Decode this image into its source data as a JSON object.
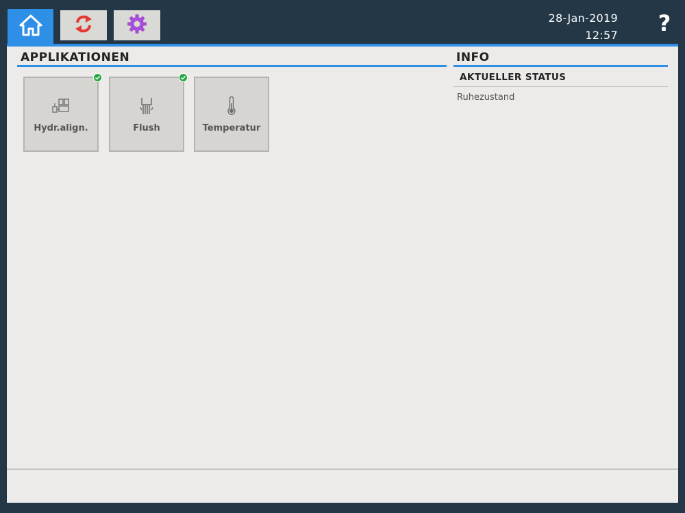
{
  "header": {
    "date": "28-Jan-2019",
    "time": "12:57",
    "help_label": "?",
    "tabs": [
      {
        "name": "home",
        "icon": "home-icon",
        "active": true
      },
      {
        "name": "sync",
        "icon": "sync-arrows-icon",
        "active": false
      },
      {
        "name": "settings",
        "icon": "gear-icon",
        "active": false
      }
    ]
  },
  "applications": {
    "title": "APPLIKATIONEN",
    "items": [
      {
        "label": "Hydr.align.",
        "icon": "hydraulic-align-icon",
        "completed": true
      },
      {
        "label": "Flush",
        "icon": "flush-icon",
        "completed": true
      },
      {
        "label": "Temperatur",
        "icon": "thermometer-icon",
        "completed": false
      }
    ]
  },
  "info": {
    "title": "INFO",
    "status_heading": "AKTUELLER STATUS",
    "status_value": "Ruhezustand"
  },
  "colors": {
    "accent": "#2e8fe6",
    "frame": "#233746",
    "panel": "#ecebe9",
    "tile": "#d6d5d1",
    "success": "#27a844",
    "sync_icon": "#e53935",
    "gear_icon": "#a64ed6"
  }
}
